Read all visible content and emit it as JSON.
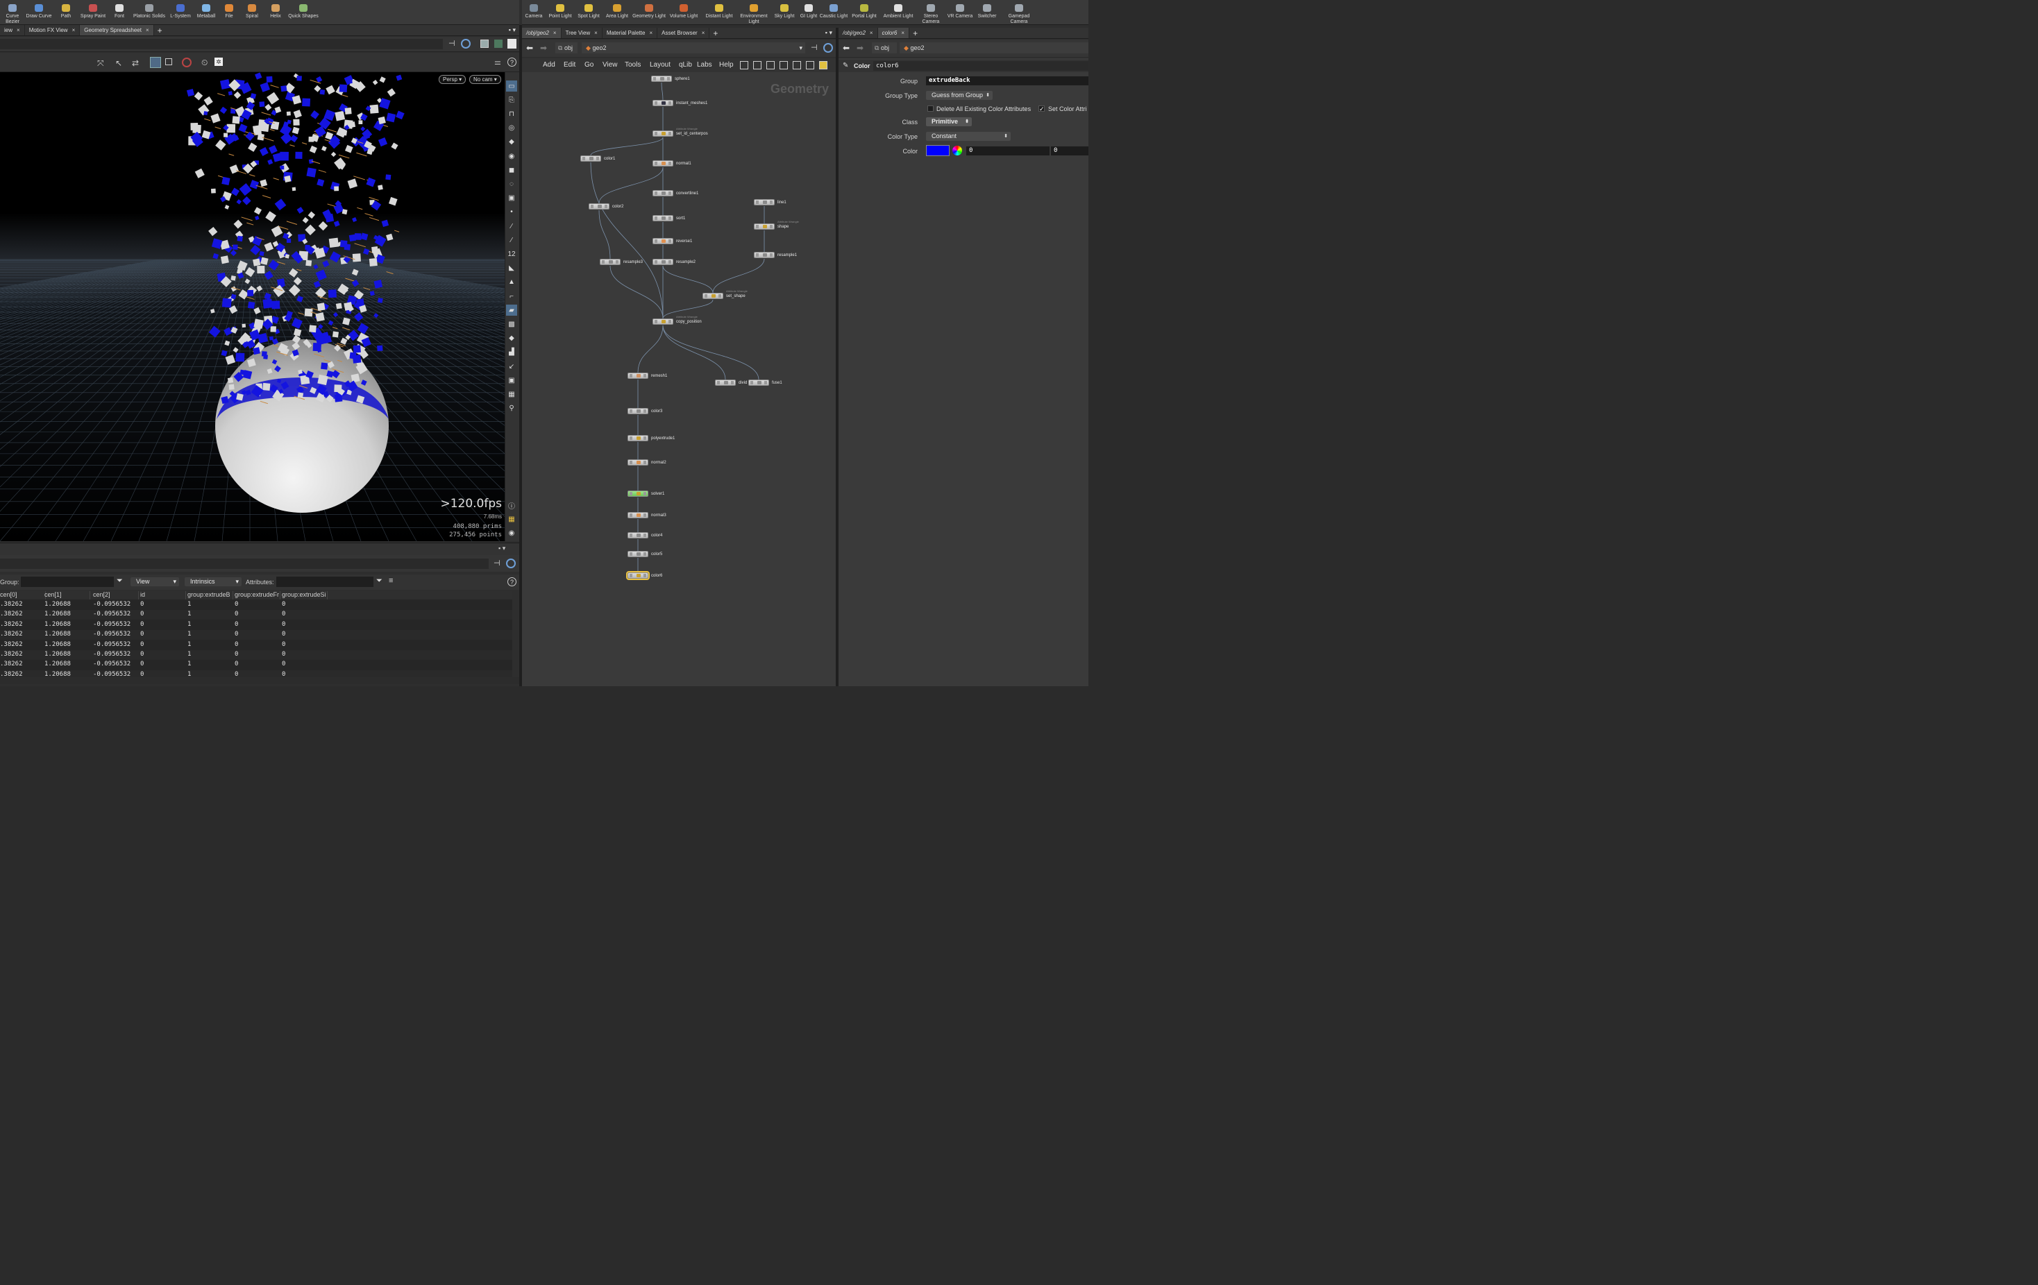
{
  "shelf_left": [
    {
      "label": "Curve Bezier",
      "icon": "curve-bezier-icon"
    },
    {
      "label": "Draw Curve",
      "icon": "draw-curve-icon"
    },
    {
      "label": "Path",
      "icon": "path-icon"
    },
    {
      "label": "Spray Paint",
      "icon": "spray-paint-icon"
    },
    {
      "label": "Font",
      "icon": "font-icon"
    },
    {
      "label": "Platonic Solids",
      "icon": "platonic-icon"
    },
    {
      "label": "L-System",
      "icon": "lsystem-icon"
    },
    {
      "label": "Metaball",
      "icon": "metaball-icon"
    },
    {
      "label": "File",
      "icon": "file-icon"
    },
    {
      "label": "Spiral",
      "icon": "spiral-icon"
    },
    {
      "label": "Helix",
      "icon": "helix-icon"
    },
    {
      "label": "Quick Shapes",
      "icon": "quick-shapes-icon"
    }
  ],
  "shelf_right": [
    {
      "label": "Camera",
      "icon": "camera-icon"
    },
    {
      "label": "Point Light",
      "icon": "point-light-icon"
    },
    {
      "label": "Spot Light",
      "icon": "spot-light-icon"
    },
    {
      "label": "Area Light",
      "icon": "area-light-icon"
    },
    {
      "label": "Geometry Light",
      "icon": "geometry-light-icon"
    },
    {
      "label": "Volume Light",
      "icon": "volume-light-icon"
    },
    {
      "label": "Distant Light",
      "icon": "distant-light-icon"
    },
    {
      "label": "Environment Light",
      "icon": "environment-light-icon"
    },
    {
      "label": "Sky Light",
      "icon": "sky-light-icon"
    },
    {
      "label": "GI Light",
      "icon": "gi-light-icon"
    },
    {
      "label": "Caustic Light",
      "icon": "caustic-light-icon"
    },
    {
      "label": "Portal Light",
      "icon": "portal-light-icon"
    },
    {
      "label": "Ambient Light",
      "icon": "ambient-light-icon"
    },
    {
      "label": "Stereo Camera",
      "icon": "stereo-camera-icon"
    },
    {
      "label": "VR Camera",
      "icon": "vr-camera-icon"
    },
    {
      "label": "Switcher",
      "icon": "switcher-icon"
    },
    {
      "label": "Gamepad Camera",
      "icon": "gamepad-camera-icon"
    }
  ],
  "left_tabs": [
    "iew",
    "Motion FX View",
    "Geometry Spreadsheet"
  ],
  "mid_tabs": [
    "/obj/geo2",
    "Tree View",
    "Material Palette",
    "Asset Browser"
  ],
  "right_tabs": [
    "/obj/geo2",
    "color6"
  ],
  "viewport": {
    "persp": "Persp",
    "cam": "No cam",
    "fps": ">120.0fps",
    "ms": "7.68ms",
    "prims": "408,880  prims",
    "points": "275,456 points"
  },
  "network": {
    "path_obj": "obj",
    "path_geo": "geo2",
    "menu": [
      "Add",
      "Edit",
      "Go",
      "View",
      "Tools",
      "Layout",
      "qLib",
      "Labs",
      "Help"
    ],
    "context_label": "Geometry",
    "nodes": [
      {
        "name": "sphere1",
        "sub": ""
      },
      {
        "name": "instant_meshes1",
        "sub": ""
      },
      {
        "name": "set_id_centerpos",
        "sub": "Attribute Wrangle"
      },
      {
        "name": "color1",
        "sub": ""
      },
      {
        "name": "normal1",
        "sub": ""
      },
      {
        "name": "convertline1",
        "sub": ""
      },
      {
        "name": "color2",
        "sub": ""
      },
      {
        "name": "sort1",
        "sub": ""
      },
      {
        "name": "reverse1",
        "sub": ""
      },
      {
        "name": "resample3",
        "sub": ""
      },
      {
        "name": "resample2",
        "sub": ""
      },
      {
        "name": "line1",
        "sub": ""
      },
      {
        "name": "shape",
        "sub": "Attribute Wrangle"
      },
      {
        "name": "resample1",
        "sub": ""
      },
      {
        "name": "set_shape",
        "sub": "Attribute Wrangle"
      },
      {
        "name": "copy_position",
        "sub": "Attribute Wrangle"
      },
      {
        "name": "remesh1",
        "sub": ""
      },
      {
        "name": "divid",
        "sub": ""
      },
      {
        "name": "fuse1",
        "sub": ""
      },
      {
        "name": "color3",
        "sub": ""
      },
      {
        "name": "polyextrude1",
        "sub": ""
      },
      {
        "name": "normal2",
        "sub": ""
      },
      {
        "name": "solver1",
        "sub": ""
      },
      {
        "name": "normal3",
        "sub": ""
      },
      {
        "name": "color4",
        "sub": ""
      },
      {
        "name": "color5",
        "sub": ""
      },
      {
        "name": "color6",
        "sub": ""
      }
    ]
  },
  "params": {
    "path_obj": "obj",
    "path_geo": "geo2",
    "node_type": "Color",
    "node_name": "color6",
    "group_label": "Group",
    "group_value": "extrudeBack",
    "group_type_label": "Group Type",
    "group_type_value": "Guess from Group",
    "delete_label": "Delete All Existing Color Attributes",
    "set_color_label": "Set Color Attri",
    "class_label": "Class",
    "class_value": "Primitive",
    "color_type_label": "Color Type",
    "color_type_value": "Constant",
    "color_label": "Color",
    "color_swatch": "#0000ff",
    "color_r": "0",
    "color_g": "0"
  },
  "spreadsheet": {
    "group_label": "Group:",
    "view_label": "View",
    "intrinsics_label": "Intrinsics",
    "attributes_label": "Attributes:",
    "columns": [
      "cen[0]",
      "cen[1]",
      "cen[2]",
      "id",
      "group:extrudeB",
      "group:extrudeFr",
      "group:extrudeSi"
    ],
    "rows": [
      [
        ".38262",
        "1.20688",
        "-0.0956532",
        "0",
        "1",
        "0",
        "0"
      ],
      [
        ".38262",
        "1.20688",
        "-0.0956532",
        "0",
        "1",
        "0",
        "0"
      ],
      [
        ".38262",
        "1.20688",
        "-0.0956532",
        "0",
        "1",
        "0",
        "0"
      ],
      [
        ".38262",
        "1.20688",
        "-0.0956532",
        "0",
        "1",
        "0",
        "0"
      ],
      [
        ".38262",
        "1.20688",
        "-0.0956532",
        "0",
        "1",
        "0",
        "0"
      ],
      [
        ".38262",
        "1.20688",
        "-0.0956532",
        "0",
        "1",
        "0",
        "0"
      ],
      [
        ".38262",
        "1.20688",
        "-0.0956532",
        "0",
        "1",
        "0",
        "0"
      ],
      [
        ".38262",
        "1.20688",
        "-0.0956532",
        "0",
        "1",
        "0",
        "0"
      ]
    ]
  },
  "colors": {
    "accent_blue": "#0000ff",
    "solver_green": "#7cd36a",
    "selected_ring": "#6a7bd8"
  }
}
